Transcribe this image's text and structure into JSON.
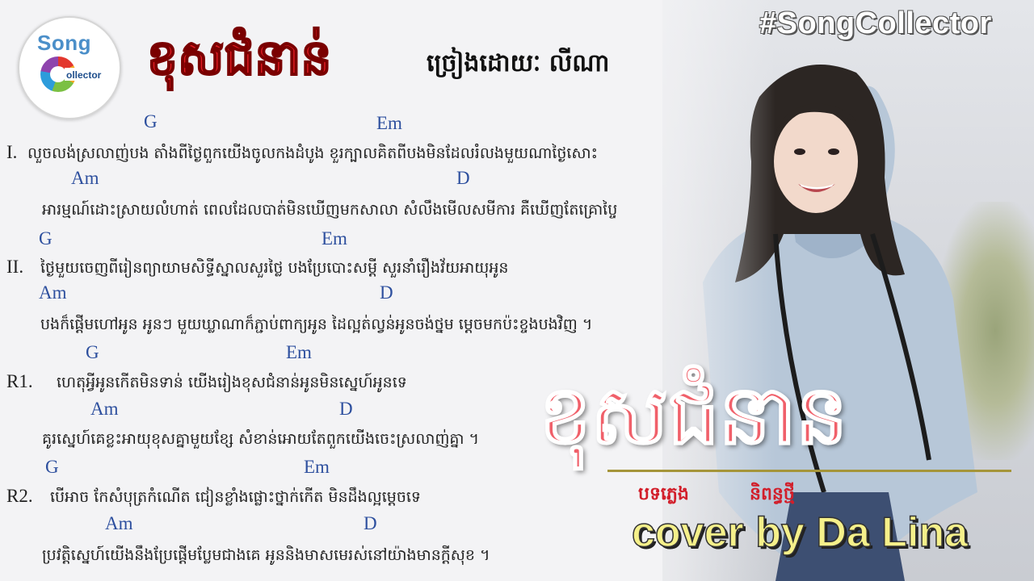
{
  "header": {
    "logo_top": "Song",
    "logo_bottom": "ollector",
    "title": "ខុសជំនាន់",
    "credit": "ច្រៀងដោយៈ លីណា",
    "hashtag": "#SongCollector"
  },
  "lyrics": {
    "v1_label": "I.",
    "v1_chord_1": "G",
    "v1_chord_2": "Em",
    "v1_line_1": "លួចលង់ស្រលាញ់បង តាំងពីថ្ងៃពួកយើងចូលកងដំបូង ខួរក្បាលគិតពីបងមិនដែលរំលងមួយណាថ្ងៃសោះ",
    "v1_chord_3": "Am",
    "v1_chord_4": "D",
    "v1_line_2": "អារម្មណ៍ដោះស្រាយលំហាត់ ពេលដែលបាត់មិនឃើញមកសាលា សំលឹងមើលសមីការ គឺឃើញតែគ្រោប្ចៃ",
    "v2_label": "II.",
    "v2_chord_1": "G",
    "v2_chord_2": "Em",
    "v2_line_1": "ថ្ងៃមួយចេញពីរៀនព្យាយាមសិទ្ធីស្នាលសួរថ្លៃ បងប្រែបោះសម្ដី សួរនាំរឿងវ័យអាយុអូន",
    "v2_chord_3": "Am",
    "v2_chord_4": "D",
    "v2_line_2": "បងក៏ផ្ដើមហៅអូន អូនៗ មួយឃ្លាណាក៏ភ្ជាប់ពាក្យអូន ដៃល្អត់ល្វន់អូនចង់ថ្នម ម្ដេចមកប៉ះខ្ចងបងវិញ ។",
    "r1_label": "R1.",
    "r1_chord_1": "G",
    "r1_chord_2": "Em",
    "r1_line_1": "ហេតុអ្វីអូនកើតមិនទាន់ យើងរៀងខុសជំនាន់អូនមិនស្នេហ៍អូនទេ",
    "r1_chord_3": "Am",
    "r1_chord_4": "D",
    "r1_line_2": "គូរស្នេហ៍គេខ្លះអាយុខុសគ្នាមួយខ្សែ សំខាន់អោយតែពួកយើងចេះស្រលាញ់គ្នា ។",
    "r2_label": "R2.",
    "r2_chord_1": "G",
    "r2_chord_2": "Em",
    "r2_line_1": "បើអាច កែសំបុត្រកំណើត ជៀនខ្លាំងផ្លោះថ្នាក់កើត មិនដឹងល្អម្ដេចទេ",
    "r2_chord_3": "Am",
    "r2_chord_4": "D",
    "r2_line_2": "ប្រវត្តិស្នេហ៍យើងនឹងប្រែផ្ដើមប្លែមជាងគេ អូននិងមាសមេរស់នៅយ៉ាងមានក្ដីសុខ ។"
  },
  "cover_art": {
    "title": "ខុសជំនាន",
    "credit_left": "បទភ្លេង",
    "credit_right": "និពន្ធថ្មី",
    "cover_text": "cover by Da Lina"
  },
  "colors": {
    "title_red": "#e21d24",
    "chord_blue": "#2d4f9e",
    "big_title_pink": "#f0606a",
    "cover_yellow": "#f5f08a"
  }
}
